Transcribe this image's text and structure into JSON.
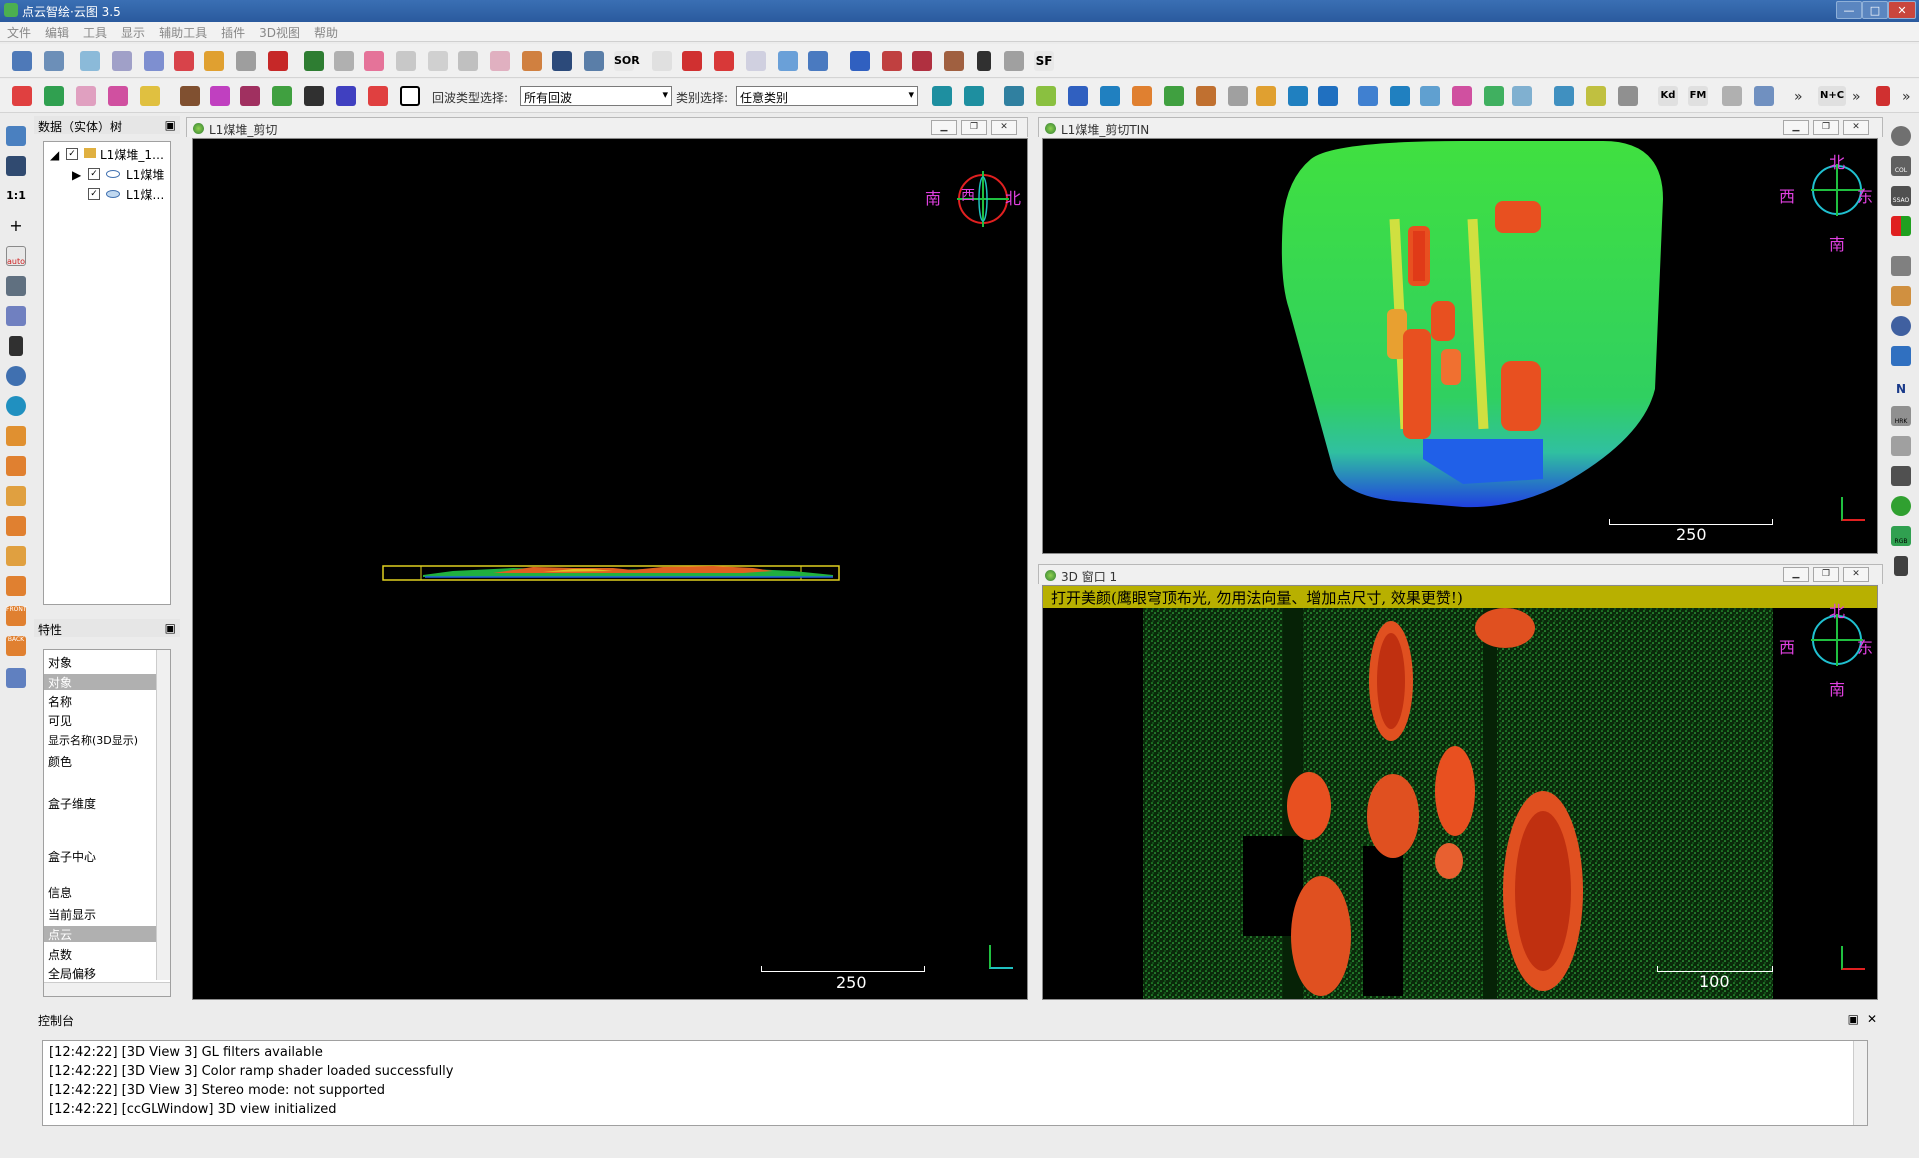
{
  "window": {
    "title": "点云智绘·云图 3.5",
    "controls": [
      "—",
      "□",
      "✕"
    ]
  },
  "menu": [
    "文件",
    "编辑",
    "工具",
    "显示",
    "辅助工具",
    "插件",
    "3D视图",
    "帮助"
  ],
  "toolbar2": {
    "echo_label": "回波类型选择:",
    "echo_value": "所有回波",
    "class_label": "类别选择:",
    "class_value": "任意类别",
    "sor_label": "SOR",
    "sf_label": "SF",
    "kd_label": "Kd",
    "fm_label": "FM",
    "nc_label": "N+C",
    "more1": "»",
    "more2": "»",
    "more3": "»"
  },
  "db_tree": {
    "title": "数据（实体）树",
    "items": [
      {
        "label": "L1煤堆_1…",
        "checked": true
      },
      {
        "label": "L1煤堆",
        "checked": true
      },
      {
        "label": "L1煤…",
        "checked": true
      }
    ]
  },
  "properties": {
    "title": "特性",
    "rows": [
      "对象",
      "对象",
      "名称",
      "可见",
      "显示名称(3D显示)",
      "颜色",
      "盒子维度",
      "盒子中心",
      "信息",
      "当前显示",
      "点云",
      "点数",
      "全局偏移"
    ]
  },
  "views": {
    "left": {
      "title": "L1煤堆_剪切",
      "scale": "250",
      "compass": {
        "s": "南",
        "w": "西",
        "n": "北"
      }
    },
    "top_right": {
      "title": "L1煤堆_剪切TIN",
      "scale": "250",
      "compass": {
        "n": "北",
        "w": "西",
        "e": "东",
        "s": "南"
      }
    },
    "bottom_right": {
      "title": "3D 窗口 1",
      "banner": "打开美颜(鹰眼穹顶布光, 勿用法向量、增加点尺寸, 效果更赞!)",
      "scale": "100",
      "compass": {
        "n": "北",
        "w": "西",
        "e": "东",
        "s": "南"
      }
    }
  },
  "console": {
    "title": "控制台",
    "lines": [
      "[12:42:22] [3D View 3] GL filters available",
      "[12:42:22] [3D View 3] Color ramp shader loaded successfully",
      "[12:42:22] [3D View 3] Stereo mode: not supported",
      "[12:42:22] [ccGLWindow] 3D view initialized"
    ]
  },
  "left_toolbar_text": {
    "ratio": "1:1",
    "auto": "auto",
    "front": "FRONT",
    "back": "BACK"
  },
  "right_toolbar_text": {
    "n": "N",
    "hrk": "HRK",
    "rgb": "RGB",
    "col": "COL",
    "ssao": "SSAO"
  }
}
